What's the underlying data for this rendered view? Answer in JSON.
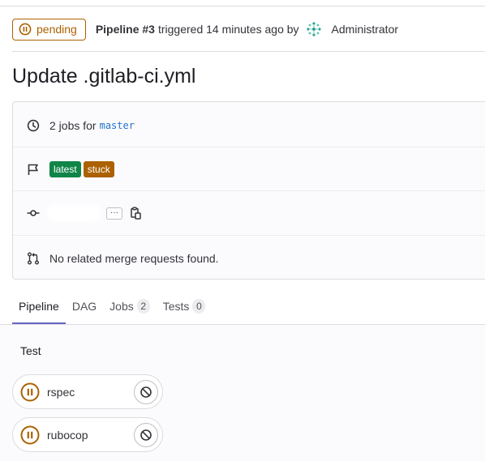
{
  "header": {
    "status_label": "pending",
    "pipeline_label": "Pipeline #3",
    "triggered_text": "triggered 14 minutes ago by",
    "user": "Administrator"
  },
  "commit_title": "Update .gitlab-ci.yml",
  "info": {
    "jobs_text": "2 jobs for",
    "branch": "master",
    "badges": [
      "latest",
      "stuck"
    ],
    "ellipsis": "···",
    "merge_requests_text": "No related merge requests found."
  },
  "tabs": [
    {
      "label": "Pipeline"
    },
    {
      "label": "DAG"
    },
    {
      "label": "Jobs",
      "count": "2"
    },
    {
      "label": "Tests",
      "count": "0"
    }
  ],
  "stage": {
    "title": "Test",
    "jobs": [
      {
        "name": "rspec"
      },
      {
        "name": "rubocop"
      }
    ]
  },
  "icons": {
    "status": "pause-circle-icon",
    "clock": "clock-icon",
    "flag": "flag-icon",
    "commit": "commit-icon",
    "merge_request": "merge-request-icon",
    "copy": "clipboard-icon",
    "cancel": "cancel-icon"
  },
  "colors": {
    "pending": "#ab6100",
    "latest_badge": "#108548",
    "stuck_badge": "#ab6100",
    "link": "#1f75cb",
    "active_tab": "#6666c4"
  }
}
